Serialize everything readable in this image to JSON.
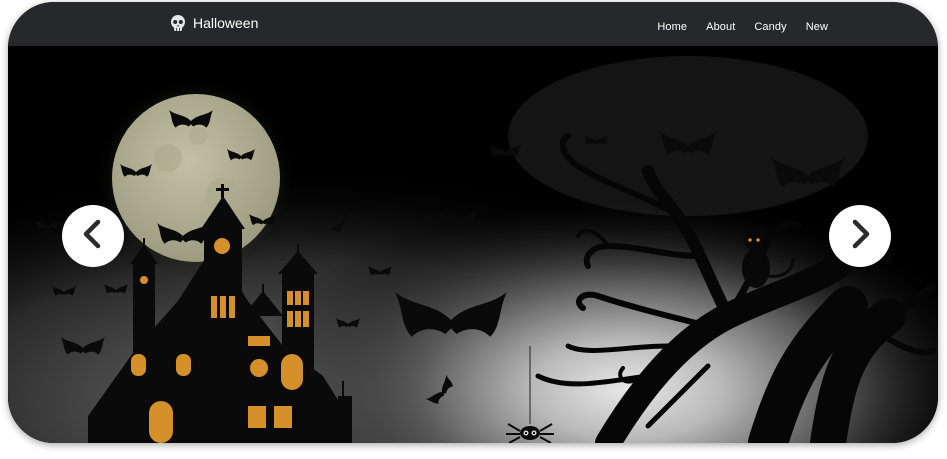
{
  "header": {
    "brand": "Halloween",
    "brand_icon": "skull-icon"
  },
  "nav": {
    "items": [
      {
        "label": "Home"
      },
      {
        "label": "About"
      },
      {
        "label": "Candy"
      },
      {
        "label": "New"
      }
    ]
  },
  "carousel": {
    "prev_icon": "chevron-left-icon",
    "next_icon": "chevron-right-icon",
    "slide_image": "halloween-night-scene"
  },
  "colors": {
    "navbar_bg": "#26282c",
    "moon": "#b8b79a",
    "window_glow": "#e0961e"
  }
}
